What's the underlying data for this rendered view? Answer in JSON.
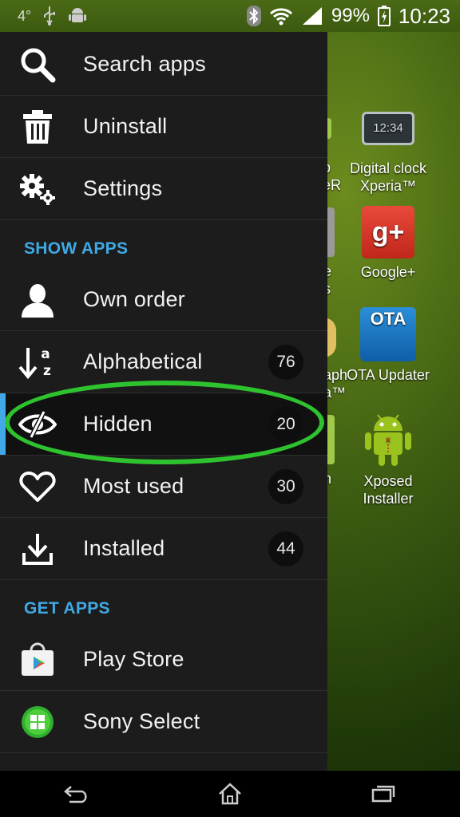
{
  "status_bar": {
    "temperature": "4°",
    "battery": "99%",
    "time": "10:23"
  },
  "drawer": {
    "top_items": [
      {
        "label": "Search apps",
        "icon": "search-icon"
      },
      {
        "label": "Uninstall",
        "icon": "trash-icon"
      },
      {
        "label": "Settings",
        "icon": "gears-icon"
      }
    ],
    "show_apps_header": "SHOW APPS",
    "show_apps": [
      {
        "label": "Own order",
        "icon": "person-icon",
        "count": ""
      },
      {
        "label": "Alphabetical",
        "icon": "sort-az-icon",
        "count": "76"
      },
      {
        "label": "Hidden",
        "icon": "hidden-eye-icon",
        "count": "20",
        "selected": true
      },
      {
        "label": "Most used",
        "icon": "heart-icon",
        "count": "30"
      },
      {
        "label": "Installed",
        "icon": "download-icon",
        "count": "44"
      }
    ],
    "get_apps_header": "GET APPS",
    "get_apps": [
      {
        "label": "Play Store",
        "icon": "play-store-icon"
      },
      {
        "label": "Sony Select",
        "icon": "sony-select-icon"
      }
    ]
  },
  "home_screen": {
    "apps": [
      {
        "label_line1": "Digital clock",
        "label_line2": "Xperia™",
        "tile_text": "12:34"
      },
      {
        "label_line1": "Google+",
        "label_line2": "",
        "tile_text": "g+"
      },
      {
        "label_line1": "OTA Updater",
        "label_line2": "",
        "tile_text": "OTA"
      },
      {
        "label_line1": "Xposed",
        "label_line2": "Installer",
        "tile_text": ""
      }
    ],
    "partial_labels": [
      "p",
      "eR",
      "e",
      "s",
      "aph",
      "a™",
      "n"
    ]
  },
  "colors": {
    "accent": "#3fa9e4",
    "highlight_ring": "#2ec32e",
    "drawer_bg": "#1c1c1c"
  }
}
